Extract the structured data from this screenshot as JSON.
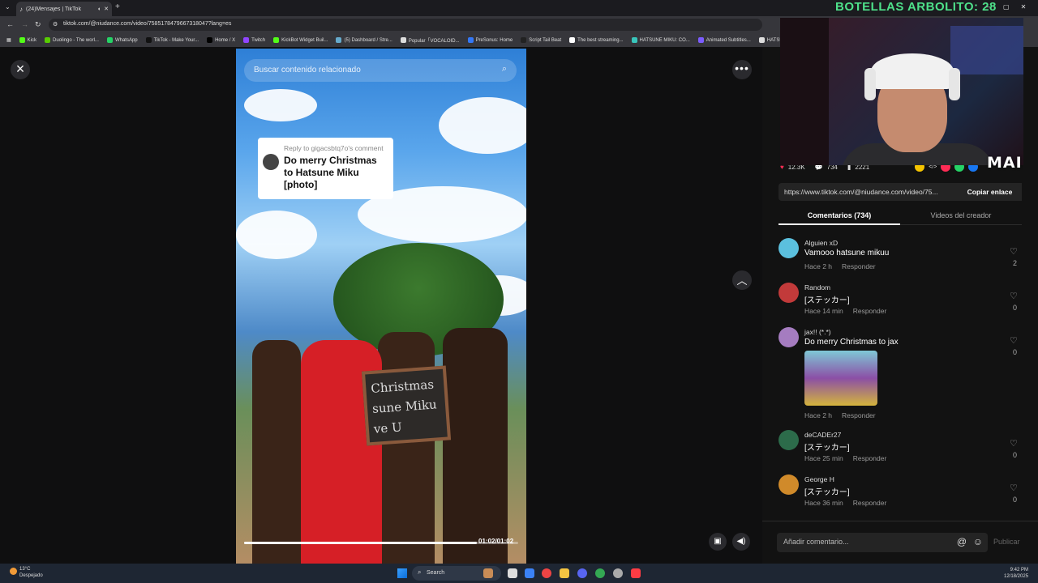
{
  "browser": {
    "tab_title": "(24)Mensajes | TikTok",
    "url": "tiktok.com/@niudance.com/video/7585178479667318047?lang=es",
    "bookmarks": [
      {
        "label": "Kick",
        "color": "#53fc18"
      },
      {
        "label": "Duolingo - The worl...",
        "color": "#58cc02"
      },
      {
        "label": "WhatsApp",
        "color": "#25d366"
      },
      {
        "label": "TikTok - Make Your...",
        "color": "#111111"
      },
      {
        "label": "Home / X",
        "color": "#000000"
      },
      {
        "label": "Twitch",
        "color": "#9146ff"
      },
      {
        "label": "KickBot Widget Buil...",
        "color": "#53fc18"
      },
      {
        "label": "(5) Dashboard / Stre...",
        "color": "#6ac"
      },
      {
        "label": "Popular「VOCALOID...",
        "color": "#ddd"
      },
      {
        "label": "PreSonus: Home",
        "color": "#3478f6"
      },
      {
        "label": "Script Tail Beat",
        "color": "#222"
      },
      {
        "label": "The best streaming...",
        "color": "#fff"
      },
      {
        "label": "HATSUNE MIKU: CO...",
        "color": "#39c5bb"
      },
      {
        "label": "Animated Subtitles...",
        "color": "#7c5cff"
      },
      {
        "label": "HATSUNE MIKU...",
        "color": "#ddd"
      }
    ]
  },
  "overlay": {
    "title": "BOTELLAS ARBOLITO: 28",
    "watermark": "MAI"
  },
  "video": {
    "search_placeholder": "Buscar contenido relacionado",
    "reply_sub": "Reply to gigacsbtq7o's comment",
    "reply_text": "Do merry Christmas to Hatsune Miku [photo]",
    "sign_text": "Christmas sune Miku ve U",
    "time": "01:02/01:02",
    "progress": 0.85
  },
  "panel": {
    "stats": {
      "likes": "12.3K",
      "comments": "734",
      "saves": "2221"
    },
    "link": "https://www.tiktok.com/@niudance.com/video/75...",
    "copy_label": "Copiar enlace",
    "tab_comments": "Comentarios (734)",
    "tab_videos": "Videos del creador",
    "comments": [
      {
        "user": "Alguien xD",
        "text": "Vamooo hatsune mikuu",
        "time": "Hace 2 h",
        "reply": "Responder",
        "likes": "2",
        "avatar_color": "#5bc0de"
      },
      {
        "user": "Random",
        "text": "[ステッカー]",
        "time": "Hace 14 min",
        "reply": "Responder",
        "likes": "0",
        "avatar_color": "#c23a3a"
      },
      {
        "user": "jax!! (*.*)",
        "text": "Do merry Christmas to jax",
        "time": "Hace 2 h",
        "reply": "Responder",
        "likes": "0",
        "avatar_color": "#a57cc0"
      },
      {
        "user": "deCADEr27",
        "text": "[ステッカー]",
        "time": "Hace 25 min",
        "reply": "Responder",
        "likes": "0",
        "avatar_color": "#2c6b4a"
      },
      {
        "user": "George H",
        "text": "[ステッカー]",
        "time": "Hace 36 min",
        "reply": "Responder",
        "likes": "0",
        "avatar_color": "#d08a2a"
      }
    ],
    "comment_placeholder": "Añadir comentario...",
    "post_label": "Publicar"
  },
  "taskbar": {
    "weather_temp": "13°C",
    "weather_text": "Despejado",
    "search_label": "Search",
    "time": "9:42 PM",
    "date": "12/18/2025"
  }
}
